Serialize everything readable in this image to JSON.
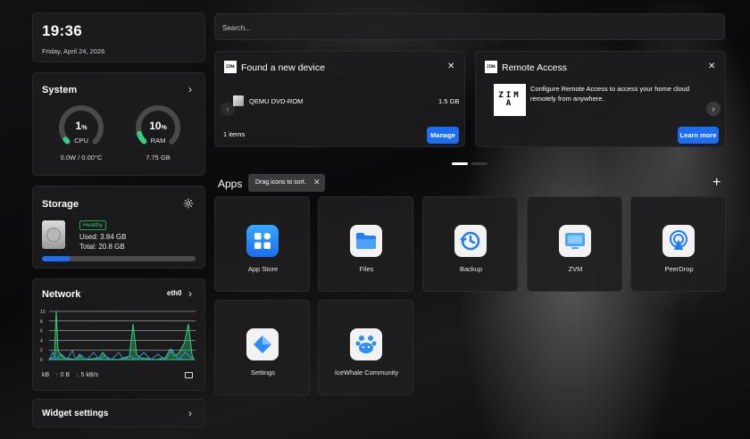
{
  "clock": {
    "time": "19:36",
    "date": "Friday, April 24, 2026"
  },
  "system": {
    "title": "System",
    "cpu": {
      "value": "1",
      "unit": "%",
      "label": "CPU",
      "sub": "0.0W / 0.00°C",
      "level": 0.01
    },
    "ram": {
      "value": "10",
      "unit": "%",
      "label": "RAM",
      "sub": "7.75 GB",
      "level": 0.1
    }
  },
  "storage": {
    "title": "Storage",
    "badge": "Healthy",
    "used": "Used: 3.84 GB",
    "total": "Total: 20.8 GB",
    "used_fraction": 0.185
  },
  "network": {
    "title": "Network",
    "interface": "eth0",
    "y_ticks": [
      "10",
      "8",
      "6",
      "4",
      "2",
      "0"
    ],
    "unit": "kB",
    "up": "0 B",
    "down": "5 kB/s",
    "up_arrow": "↑",
    "down_arrow": "↓"
  },
  "widget_settings": {
    "label": "Widget settings"
  },
  "search": {
    "placeholder": "Search..."
  },
  "device_card": {
    "title": "Found a new device",
    "device_name": "QEMU DVD-ROM",
    "device_size": "1.5 GB",
    "count": "1 items",
    "button": "Manage"
  },
  "remote_card": {
    "title": "Remote Access",
    "description": "Configure Remote Access to access your home cloud remotely from anywhere.",
    "button": "Learn more"
  },
  "logo_text": "ZIMA",
  "apps": {
    "title": "Apps",
    "hint": "Drag icons to sort.",
    "items": [
      {
        "label": "App Store",
        "icon": "app-store-icon"
      },
      {
        "label": "Files",
        "icon": "files-icon"
      },
      {
        "label": "Backup",
        "icon": "backup-icon"
      },
      {
        "label": "ZVM",
        "icon": "zvm-icon"
      },
      {
        "label": "PeerDrop",
        "icon": "peerdrop-icon"
      },
      {
        "label": "Settings",
        "icon": "settings-icon"
      },
      {
        "label": "IceWhale Community",
        "icon": "icewhale-community-icon"
      }
    ]
  },
  "colors": {
    "accent": "#1b6ef3",
    "gauge": "#35d07f",
    "healthy": "#35c26e"
  }
}
